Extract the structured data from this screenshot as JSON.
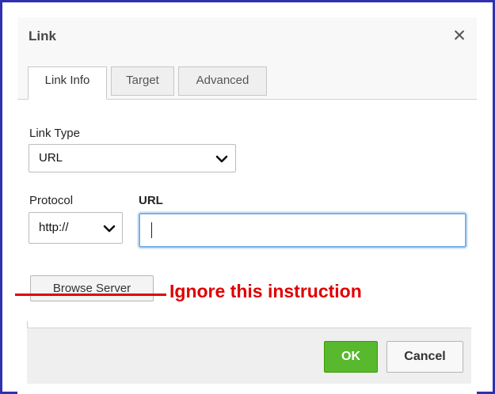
{
  "dialog": {
    "title": "Link",
    "close_icon": "close-icon"
  },
  "tabs": [
    {
      "label": "Link Info",
      "active": true
    },
    {
      "label": "Target",
      "active": false
    },
    {
      "label": "Advanced",
      "active": false
    }
  ],
  "form": {
    "link_type_label": "Link Type",
    "link_type_value": "URL",
    "protocol_label": "Protocol",
    "protocol_value": "http://",
    "url_label": "URL",
    "url_value": ""
  },
  "buttons": {
    "browse_server": "Browse Server",
    "ok": "OK",
    "cancel": "Cancel"
  },
  "annotation": {
    "text": "Ignore this instruction",
    "color": "#e00000"
  },
  "colors": {
    "ok_green": "#58b82e",
    "frame_border": "#3030b0",
    "focus_blue": "#7ab0e6"
  }
}
